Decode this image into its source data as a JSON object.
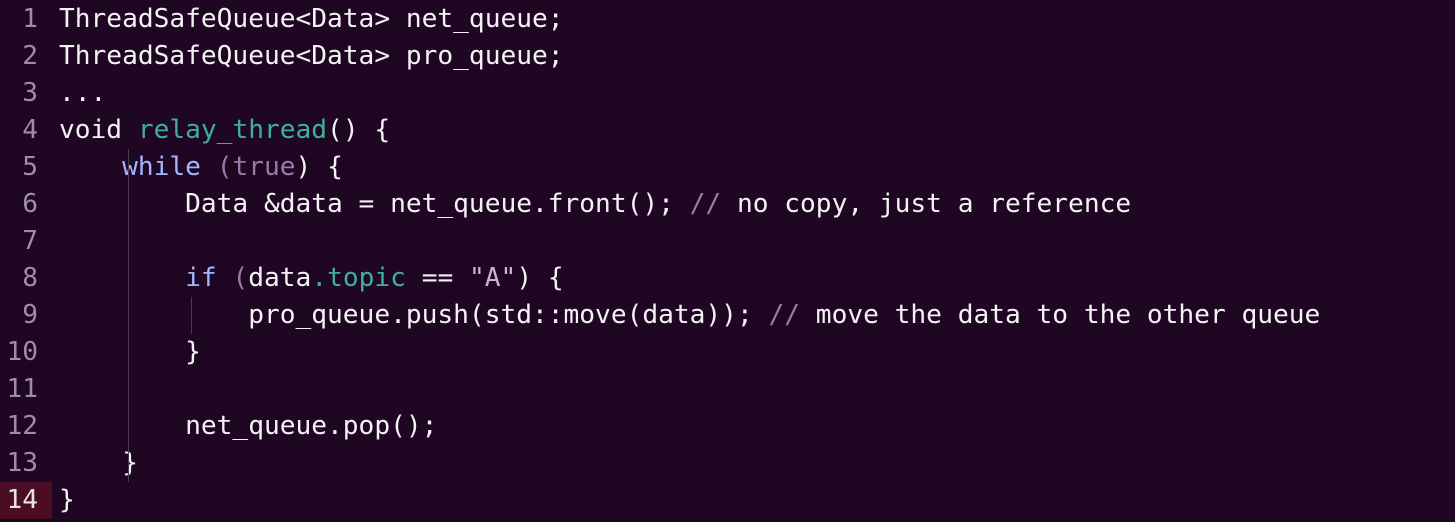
{
  "editor": {
    "lines": [
      {
        "n": "1",
        "tokens": [
          {
            "t": "ThreadSafeQueue<Data> net_queue;",
            "c": ""
          }
        ]
      },
      {
        "n": "2",
        "tokens": [
          {
            "t": "ThreadSafeQueue<Data> pro_queue;",
            "c": ""
          }
        ]
      },
      {
        "n": "3",
        "tokens": [
          {
            "t": "...",
            "c": ""
          }
        ]
      },
      {
        "n": "4",
        "tokens": [
          {
            "t": "void ",
            "c": ""
          },
          {
            "t": "relay_thread",
            "c": "fn"
          },
          {
            "t": "() {",
            "c": ""
          }
        ]
      },
      {
        "n": "5",
        "tokens": [
          {
            "t": "    ",
            "c": ""
          },
          {
            "t": "while",
            "c": "k"
          },
          {
            "t": " (",
            "c": "lit"
          },
          {
            "t": "true",
            "c": "lit"
          },
          {
            "t": ") {",
            "c": ""
          }
        ]
      },
      {
        "n": "6",
        "tokens": [
          {
            "t": "        Data &data = net_queue.front(); ",
            "c": ""
          },
          {
            "t": "// ",
            "c": "cm"
          },
          {
            "t": "no copy, just a reference",
            "c": "ct"
          }
        ]
      },
      {
        "n": "7",
        "tokens": []
      },
      {
        "n": "8",
        "tokens": [
          {
            "t": "        ",
            "c": ""
          },
          {
            "t": "if",
            "c": "k"
          },
          {
            "t": " (",
            "c": "lit"
          },
          {
            "t": "data",
            "c": ""
          },
          {
            "t": ".topic",
            "c": "prop"
          },
          {
            "t": " == ",
            "c": ""
          },
          {
            "t": "\"A\"",
            "c": "str"
          },
          {
            "t": ") {",
            "c": ""
          }
        ]
      },
      {
        "n": "9",
        "tokens": [
          {
            "t": "            pro_queue.push(std::move(data)); ",
            "c": ""
          },
          {
            "t": "// ",
            "c": "cm"
          },
          {
            "t": "move the data to the other queue",
            "c": "ct"
          }
        ]
      },
      {
        "n": "10",
        "tokens": [
          {
            "t": "        }",
            "c": ""
          }
        ]
      },
      {
        "n": "11",
        "tokens": []
      },
      {
        "n": "12",
        "tokens": [
          {
            "t": "        net_queue.pop();",
            "c": ""
          }
        ]
      },
      {
        "n": "13",
        "tokens": [
          {
            "t": "    }",
            "c": ""
          }
        ]
      },
      {
        "n": "14",
        "tokens": [
          {
            "t": "}",
            "c": ""
          }
        ]
      }
    ],
    "current_line": "14"
  }
}
